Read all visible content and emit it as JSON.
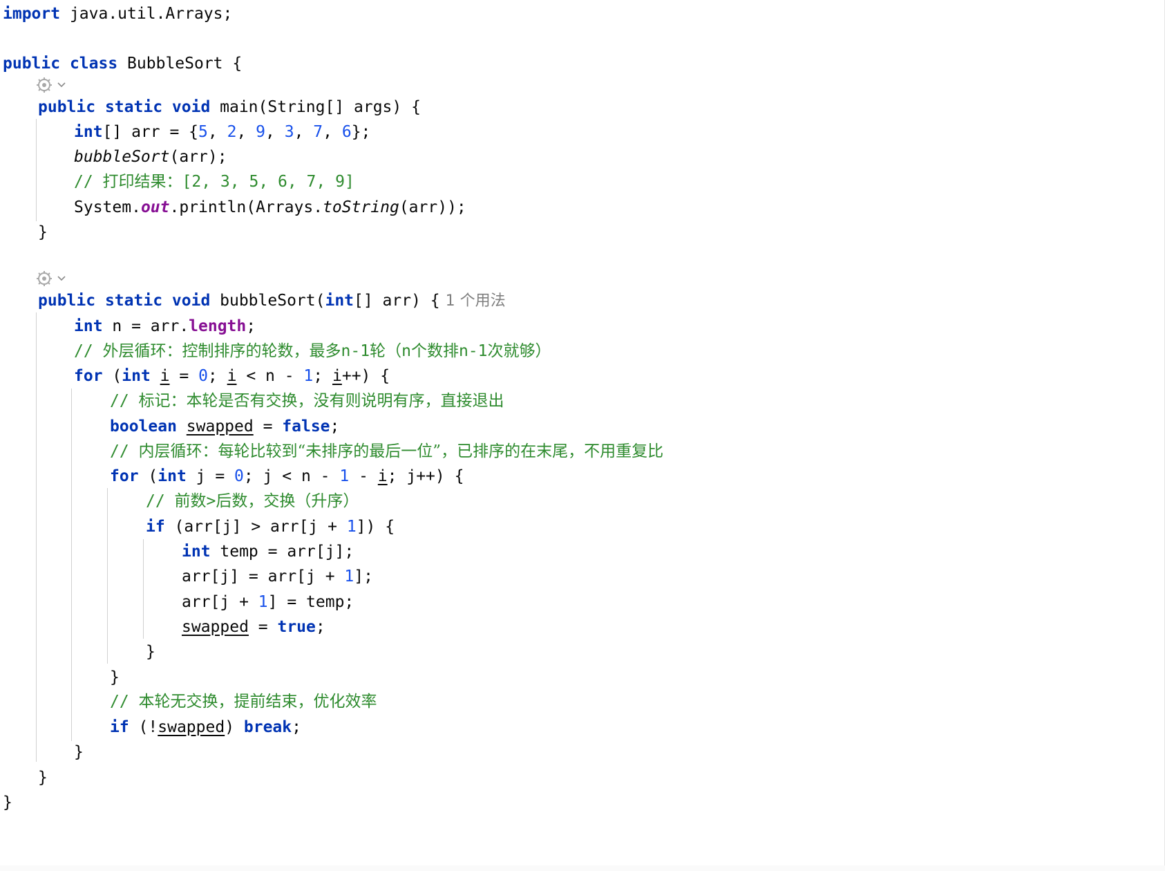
{
  "editor": {
    "lines": {
      "l1": {
        "kw": "import",
        "rest": " java.util.Arrays;"
      },
      "l2": {
        "kw1": "public",
        "kw2": "class",
        "rest": " BubbleSort {"
      },
      "l3": {
        "kw1": "public",
        "kw2": "static",
        "kw3": "void",
        "rest": " main(String[] args) {"
      },
      "l4": {
        "kw": "int",
        "a": "[] arr = {",
        "n1": "5",
        "s1": ", ",
        "n2": "2",
        "s2": ", ",
        "n3": "9",
        "s3": ", ",
        "n4": "3",
        "s4": ", ",
        "n5": "7",
        "s5": ", ",
        "n6": "6",
        "end": "};"
      },
      "l5": {
        "call": "bubbleSort",
        "rest": "(arr);"
      },
      "l6": {
        "slash": "// ",
        "cjk": "打印结果：",
        "rest": "[2, 3, 5, 6, 7, 9]"
      },
      "l7": {
        "a": "System.",
        "out": "out",
        "b": ".println(Arrays.",
        "call": "toString",
        "c": "(arr));"
      },
      "l8": {
        "text": "}"
      },
      "l9": {
        "kw1": "public",
        "kw2": "static",
        "kw3": "void",
        "a": " bubbleSort(",
        "kw4": "int",
        "b": "[] arr) {",
        "hint": "1 个用法"
      },
      "l10": {
        "kw": "int",
        "a": " n = arr.",
        "fld": "length",
        "b": ";"
      },
      "l11": {
        "slash": "// ",
        "cjk1": "外层循环：控制排序的轮数，最多",
        "m1": "n-1",
        "cjk2": "轮（",
        "m2": "n",
        "cjk3": "个数排",
        "m3": "n-1",
        "cjk4": "次就够）"
      },
      "l12": {
        "kw1": "for",
        "a": " (",
        "kw2": "int",
        "b": " ",
        "i1": "i",
        "c": " = ",
        "n0": "0",
        "d": "; ",
        "i2": "i",
        "e": " < n - ",
        "n1": "1",
        "f": "; ",
        "i3": "i",
        "g": "++) {"
      },
      "l13": {
        "slash": "// ",
        "cjk": "标记：本轮是否有交换，没有则说明有序，直接退出"
      },
      "l14": {
        "kw1": "boolean",
        "a": " ",
        "var": "swapped",
        "b": " = ",
        "kw2": "false",
        "c": ";"
      },
      "l15": {
        "slash": "// ",
        "cjk": "内层循环：每轮比较到“未排序的最后一位”，已排序的在末尾，不用重复比"
      },
      "l16": {
        "kw1": "for",
        "a": " (",
        "kw2": "int",
        "b": " j = ",
        "n0": "0",
        "c": "; j < n - ",
        "n1": "1",
        "d": " - ",
        "i": "i",
        "e": "; j++) {"
      },
      "l17": {
        "slash": "// ",
        "cjk1": "前数",
        "gt": ">",
        "cjk2": "后数，交换（升序）"
      },
      "l18": {
        "kw": "if",
        "a": " (arr[j] > arr[j + ",
        "n1": "1",
        "b": "]) {"
      },
      "l19": {
        "kw": "int",
        "a": " temp = arr[j];"
      },
      "l20": {
        "a": "arr[j] = arr[j + ",
        "n1": "1",
        "b": "];"
      },
      "l21": {
        "a": "arr[j + ",
        "n1": "1",
        "b": "] = temp;"
      },
      "l22": {
        "var": "swapped",
        "a": " = ",
        "kw": "true",
        "b": ";"
      },
      "l23": {
        "text": "}"
      },
      "l24": {
        "text": "}"
      },
      "l25": {
        "slash": "// ",
        "cjk": "本轮无交换，提前结束，优化效率"
      },
      "l26": {
        "kw1": "if",
        "a": " (!",
        "var": "swapped",
        "b": ") ",
        "kw2": "break",
        "c": ";"
      },
      "l27": {
        "text": "}"
      },
      "l28": {
        "text": "}"
      },
      "l29": {
        "text": "}"
      }
    },
    "gutter_icons": [
      "implement-method-icon",
      "chevron-down-icon"
    ],
    "colors": {
      "keyword": "#0033b3",
      "number": "#1750eb",
      "comment": "#2e8b2e",
      "field": "#871094",
      "hint": "#808080",
      "indent_guide": "#d0d0d0"
    }
  }
}
